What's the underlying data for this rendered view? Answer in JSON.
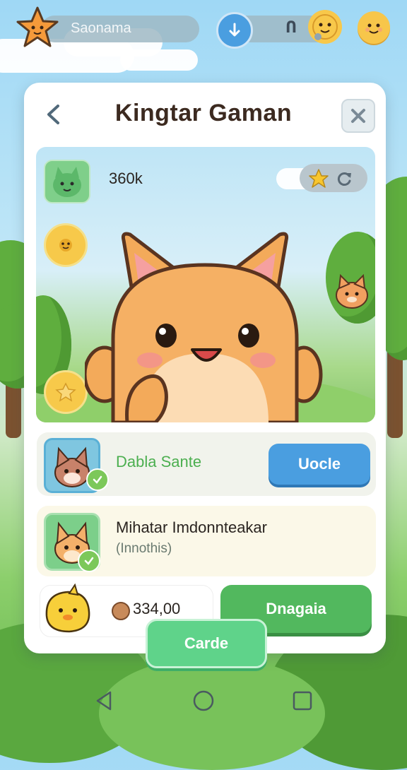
{
  "top_bar": {
    "player_name": "Saonama",
    "status_text": "Ո"
  },
  "dialog": {
    "title": "Kingtar Gaman"
  },
  "scene": {
    "score": "360k"
  },
  "row1": {
    "label": "Dabla Sante",
    "button": "Uocle"
  },
  "row2": {
    "title": "Mihatar Imdonnteakar",
    "subtitle": "(Innothis)"
  },
  "bottom": {
    "price": "334,00",
    "action_button": "Dnagaia",
    "main_button": "Carde"
  },
  "colors": {
    "accent_blue": "#4a9ee0",
    "accent_green": "#52b85e",
    "mint_green": "#5fd38a",
    "text_green": "#4caf50",
    "title_brown": "#3c2a20",
    "mascot_orange": "#f3aa5a"
  },
  "icons": [
    "star-icon",
    "arrow-down-icon",
    "magnet-icon",
    "smiley-icon",
    "back-arrow-icon",
    "close-icon",
    "refresh-icon",
    "coin-icon",
    "nav-back-icon",
    "nav-home-icon",
    "nav-recents-icon"
  ]
}
